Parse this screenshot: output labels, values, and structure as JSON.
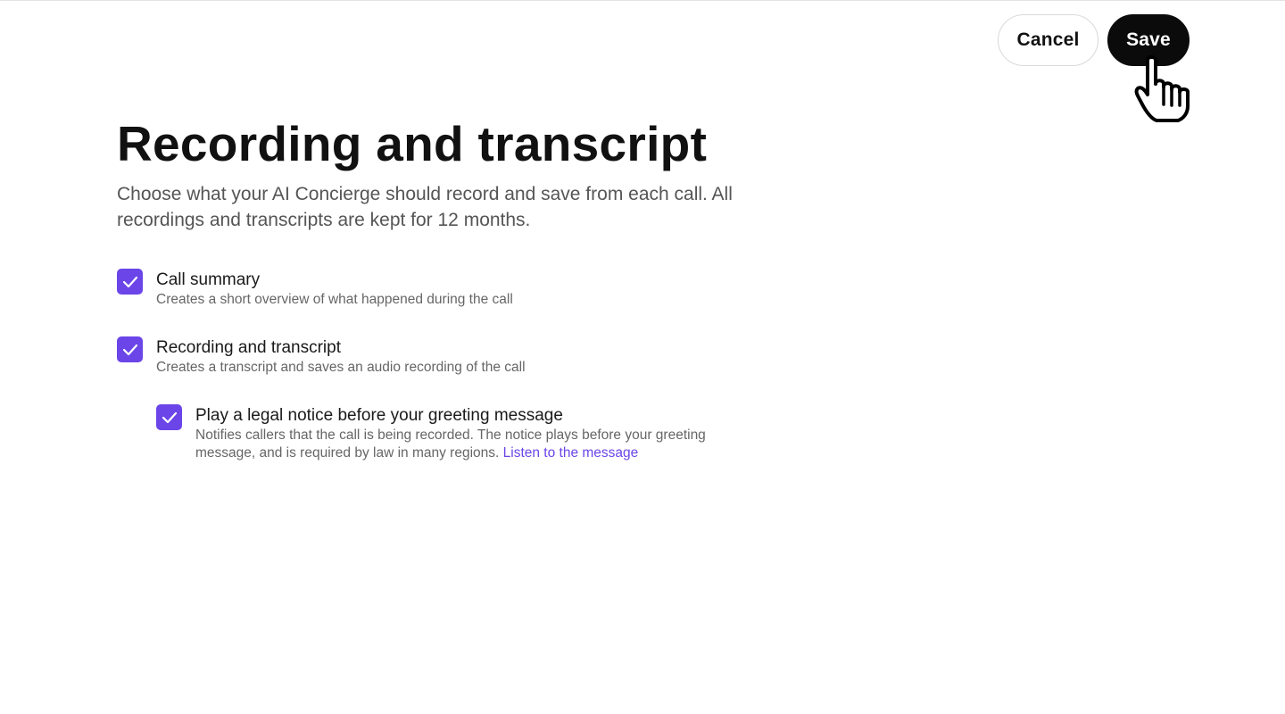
{
  "header": {
    "cancel_label": "Cancel",
    "save_label": "Save"
  },
  "main": {
    "title": "Recording and transcript",
    "subtitle": "Choose what your AI Concierge should record and save from each call. All recordings and transcripts are kept for 12 months.",
    "options": [
      {
        "label": "Call summary",
        "description": "Creates a short overview of what happened during the call",
        "checked": true
      },
      {
        "label": "Recording and transcript",
        "description": "Creates a transcript and saves an audio recording of the call",
        "checked": true
      },
      {
        "label": "Play a legal notice before your greeting message",
        "description": "Notifies callers that the call is being recorded. The notice plays before your greeting message, and is required by law in many regions.",
        "link_label": "Listen to the message",
        "checked": true
      }
    ]
  },
  "colors": {
    "accent": "#6b45e8",
    "save_button_bg": "#0b0b0b",
    "text_primary": "#1a1a1a",
    "text_secondary": "#666666"
  },
  "icons": {
    "checkbox": "check-icon",
    "cursor": "pointer-hand-icon"
  }
}
